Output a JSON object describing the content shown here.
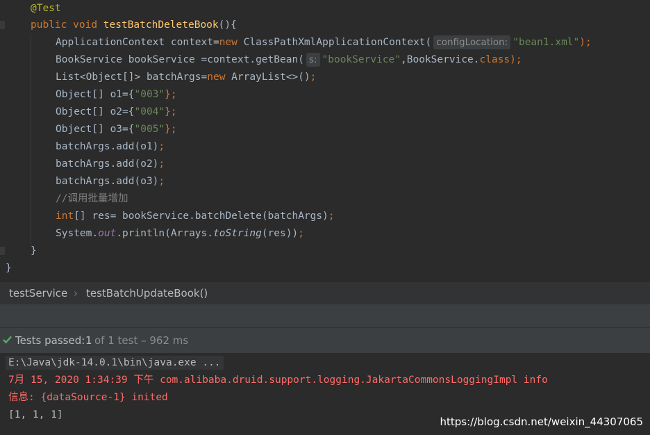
{
  "editor": {
    "annotation": "@Test",
    "l_public": "public",
    "l_void": "void",
    "method_name": "testBatchDeleteBook",
    "method_tail": "(){",
    "l3_a": "ApplicationContext context=",
    "l3_new": "new",
    "l3_b": " ClassPathXmlApplicationContext(",
    "l3_hint": "configLocation:",
    "l3_str": "\"bean1.xml\"",
    "l3_end": ");",
    "l4_a": "BookService bookService =context.getBean(",
    "l4_hint": "s:",
    "l4_str": "\"bookService\"",
    "l4_b": ",BookService.",
    "l4_class": "class",
    "l4_end": ");",
    "l5_a": "List<Object[]> batchArgs=",
    "l5_new": "new",
    "l5_b": " ArrayList<>()",
    "l5_end": ";",
    "l6_a": "Object[] o1={",
    "l6_str": "\"003\"",
    "l6_end": "};",
    "l7_a": "Object[] o2={",
    "l7_str": "\"004\"",
    "l7_end": "};",
    "l8_a": "Object[] o3={",
    "l8_str": "\"005\"",
    "l8_end": "};",
    "l9": "batchArgs.add(o1)",
    "l10": "batchArgs.add(o2)",
    "l11": "batchArgs.add(o3)",
    "semicolon": ";",
    "comment": "//调用批量增加",
    "l13_kw": "int",
    "l13_a": "[] res= bookService.batchDelete(batchArgs)",
    "l14_a": "System.",
    "l14_out": "out",
    "l14_b": ".println(Arrays.",
    "l14_ts": "toString",
    "l14_c": "(res))",
    "close_method": "}",
    "close_class": "}"
  },
  "breadcrumb": {
    "class_name": "testService",
    "separator": "›",
    "method_name": "testBatchUpdateBook()"
  },
  "run": {
    "status_label": "Tests passed:",
    "passed_count": "1",
    "of_text": "of 1 test – 962 ms",
    "console_lines": {
      "cmd": "E:\\Java\\jdk-14.0.1\\bin\\java.exe ...",
      "log1": "7月 15, 2020 1:34:39 下午 com.alibaba.druid.support.logging.JakartaCommonsLoggingImpl info",
      "log2": "信息: {dataSource-1} inited",
      "result": "[1, 1, 1]"
    },
    "watermark": "https://blog.csdn.net/weixin_44307065"
  },
  "colors": {
    "keyword": "#cc7832",
    "string": "#6a8759",
    "method": "#ffc66d",
    "annotation": "#bbb529",
    "comment": "#808080",
    "error_log": "#ff6b68",
    "success": "#59a869"
  }
}
